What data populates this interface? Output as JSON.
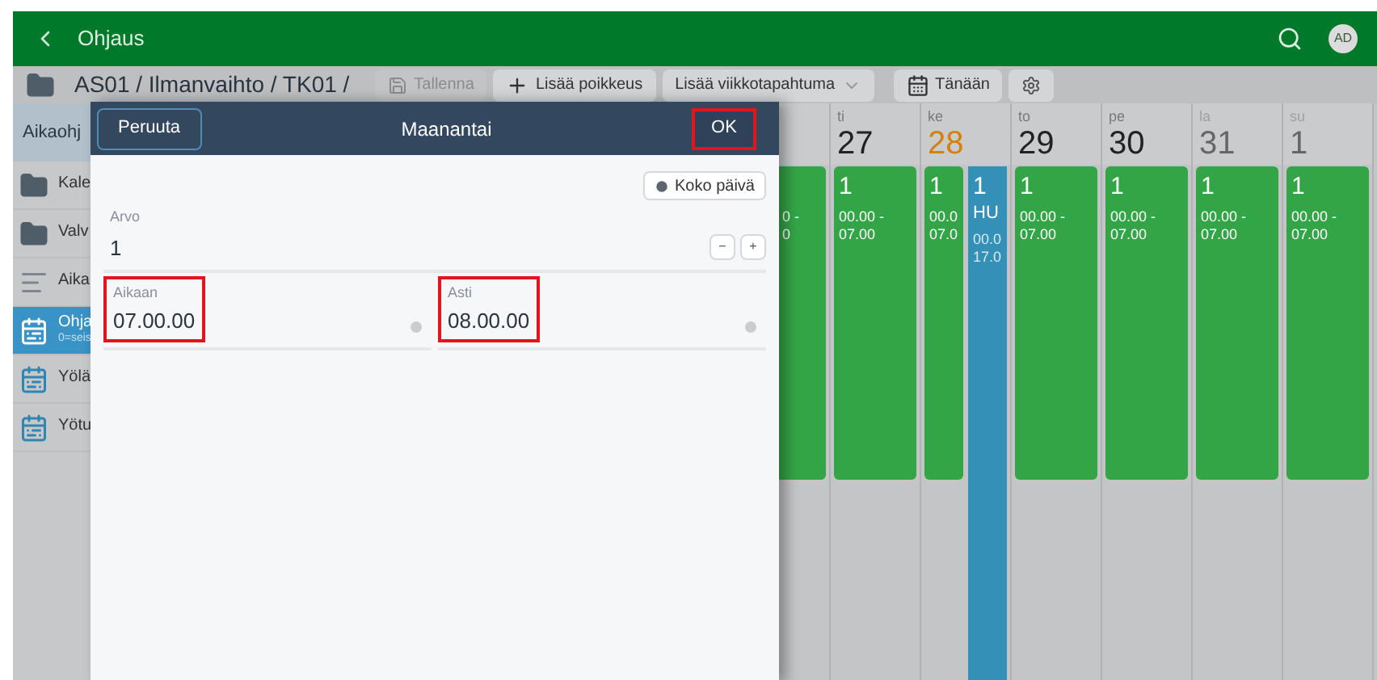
{
  "header": {
    "title": "Ohjaus",
    "avatar": "AD"
  },
  "toolbar": {
    "breadcrumb": "AS01 / Ilmanvaihto / TK01 /",
    "buttons": [
      {
        "kind": "save",
        "label": "Tallenna",
        "disabled": true
      },
      {
        "kind": "add",
        "label": "Lisää poikkeus",
        "disabled": false
      },
      {
        "kind": "dropdown",
        "label": "Lisää viikkotapahtuma",
        "disabled": false
      },
      {
        "kind": "today",
        "label": "Tänään",
        "disabled": false
      },
      {
        "kind": "settings",
        "disabled": false
      }
    ]
  },
  "sidebar": {
    "heading": "Aikaohj",
    "items": [
      {
        "kind": "folder",
        "label": "Kale",
        "selected": false
      },
      {
        "kind": "folder",
        "label": "Valv",
        "selected": false
      },
      {
        "kind": "list",
        "label": "Aika",
        "selected": false
      },
      {
        "kind": "calendar",
        "label": "Ohja",
        "sublabel": "0=seis",
        "selected": true
      },
      {
        "kind": "calendar",
        "label": "Yölä",
        "selected": false
      },
      {
        "kind": "calendar",
        "label": "Yötu",
        "selected": false
      }
    ]
  },
  "calendar": {
    "days": [
      {
        "events": [
          {
            "color": "#33a547",
            "lines": [
              "0 -",
              "0"
            ]
          }
        ]
      },
      {
        "weekday": "ti",
        "date": "27",
        "today": false,
        "weekend": false,
        "events": [
          {
            "color": "#33a547",
            "value": "1",
            "lines": [
              "00.00 -",
              "07.00"
            ]
          }
        ]
      },
      {
        "weekday": "ke",
        "date": "28",
        "today": true,
        "weekend": false,
        "events": [
          {
            "color": "#33a547",
            "value": "1",
            "lines": [
              "00.0",
              "07.0"
            ]
          },
          {
            "color": "#3590b8",
            "value": "1",
            "title": "HU",
            "lines": [
              "00.0",
              "17.0"
            ]
          }
        ]
      },
      {
        "weekday": "to",
        "date": "29",
        "today": false,
        "weekend": false,
        "events": [
          {
            "color": "#33a547",
            "value": "1",
            "lines": [
              "00.00 -",
              "07.00"
            ]
          }
        ]
      },
      {
        "weekday": "pe",
        "date": "30",
        "today": false,
        "weekend": false,
        "events": [
          {
            "color": "#33a547",
            "value": "1",
            "lines": [
              "00.00 -",
              "07.00"
            ]
          }
        ]
      },
      {
        "weekday": "la",
        "date": "31",
        "today": false,
        "weekend": true,
        "events": [
          {
            "color": "#33a547",
            "value": "1",
            "lines": [
              "00.00 -",
              "07.00"
            ]
          }
        ]
      },
      {
        "weekday": "su",
        "date": "1",
        "today": false,
        "weekend": true,
        "events": [
          {
            "color": "#33a547",
            "value": "1",
            "lines": [
              "00.00 -",
              "07.00"
            ]
          }
        ]
      }
    ]
  },
  "dialog": {
    "title": "Maanantai",
    "cancel": "Peruuta",
    "ok": {
      "label": "OK",
      "highlighted": true
    },
    "all_day": "Koko päivä",
    "value_field": {
      "label": "Arvo",
      "value": "1",
      "minus": "−",
      "plus": "+"
    },
    "time_fields": [
      {
        "label": "Aikaan",
        "value": "07.00.00",
        "highlighted": true
      },
      {
        "label": "Asti",
        "value": "08.00.00",
        "highlighted": true
      }
    ]
  }
}
